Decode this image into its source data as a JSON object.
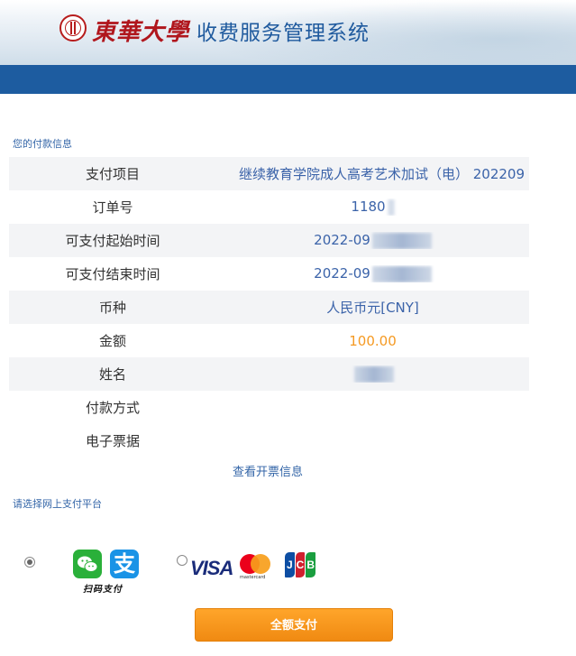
{
  "header": {
    "university_name": "東華大學",
    "system_title": "收费服务管理系统"
  },
  "payment_info": {
    "section_title": "您的付款信息",
    "rows": [
      {
        "label": "支付项目",
        "value": "继续教育学院成人高考艺术加试（电） 202209"
      },
      {
        "label": "订单号",
        "value": "1180"
      },
      {
        "label": "可支付起始时间",
        "value": "2022-09"
      },
      {
        "label": "可支付结束时间",
        "value": "2022-09"
      },
      {
        "label": "币种",
        "value": "人民币元[CNY]"
      },
      {
        "label": "金额",
        "value": "100.00"
      },
      {
        "label": "姓名",
        "value": ""
      },
      {
        "label": "付款方式",
        "value": ""
      },
      {
        "label": "电子票据",
        "value": ""
      }
    ],
    "view_invoice_link": "查看开票信息"
  },
  "payment_platform": {
    "section_title": "请选择网上支付平台",
    "options": [
      {
        "name": "scan-code",
        "label": "扫码支付",
        "selected": true
      },
      {
        "name": "card",
        "label": "VISA",
        "selected": false
      }
    ],
    "alipay_glyph": "支",
    "mastercard_text": "mastercard",
    "jcb_letters": [
      "J",
      "C",
      "B"
    ]
  },
  "actions": {
    "pay_full_label": "全额支付"
  },
  "colors": {
    "brand_blue": "#1d5ca0",
    "link_blue": "#3466a8",
    "amount_orange": "#f59a23",
    "button_orange": "#f08a12"
  }
}
